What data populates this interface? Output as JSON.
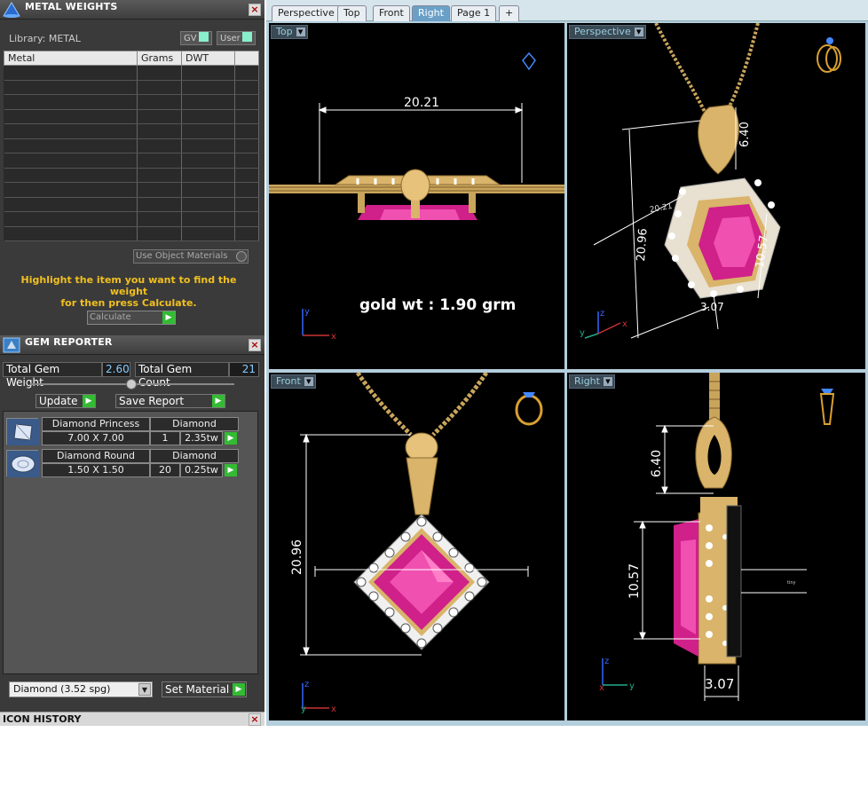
{
  "metal_weights": {
    "title": "METAL WEIGHTS",
    "library_label": "Library: METAL",
    "gv_label": "GV",
    "user_label": "User",
    "columns": [
      "Metal",
      "Grams",
      "DWT",
      ""
    ],
    "use_object_materials": "Use Object Materials",
    "hint_line1": "Highlight the item you want to find the weight",
    "hint_line2": "for then press Calculate.",
    "calculate_label": "Calculate"
  },
  "gem_reporter": {
    "title": "GEM REPORTER",
    "total_weight_label": "Total Gem Weight",
    "total_weight_value": "2.60",
    "total_count_label": "Total Gem Count",
    "total_count_value": "21",
    "update_label": "Update",
    "save_report_label": "Save Report",
    "gems": [
      {
        "name": "Diamond Princess",
        "material": "Diamond",
        "size": "7.00 X 7.00",
        "count": "1",
        "weight": "2.35tw"
      },
      {
        "name": "Diamond Round",
        "material": "Diamond",
        "size": "1.50 X 1.50",
        "count": "20",
        "weight": "0.25tw"
      }
    ],
    "material_select": "Diamond      (3.52 spg)",
    "set_material_label": "Set Material"
  },
  "icon_history": {
    "title": "ICON HISTORY"
  },
  "tabs": [
    "Perspective",
    "Top",
    "Front",
    "Right",
    "Page 1",
    "+"
  ],
  "active_tab": "Right",
  "viewports": {
    "top": {
      "label": "Top",
      "dim_width": "20.21",
      "annotation": "gold wt : 1.90 grm"
    },
    "perspective": {
      "label": "Perspective",
      "dim_bail": "6.40",
      "dim_height": "20.96",
      "dim_diag": "20.21",
      "dim_stone": "10.57",
      "dim_depth": "3.07"
    },
    "front": {
      "label": "Front",
      "dim_height": "20.96"
    },
    "right": {
      "label": "Right",
      "dim_bail": "6.40",
      "dim_stone": "10.57",
      "dim_depth": "3.07"
    }
  },
  "colors": {
    "gold": "#d9b46a",
    "ruby": "#d0208a",
    "panel": "#3a3a3a",
    "accent_blue": "#6aa0c8",
    "hint_yellow": "#f0c020"
  }
}
